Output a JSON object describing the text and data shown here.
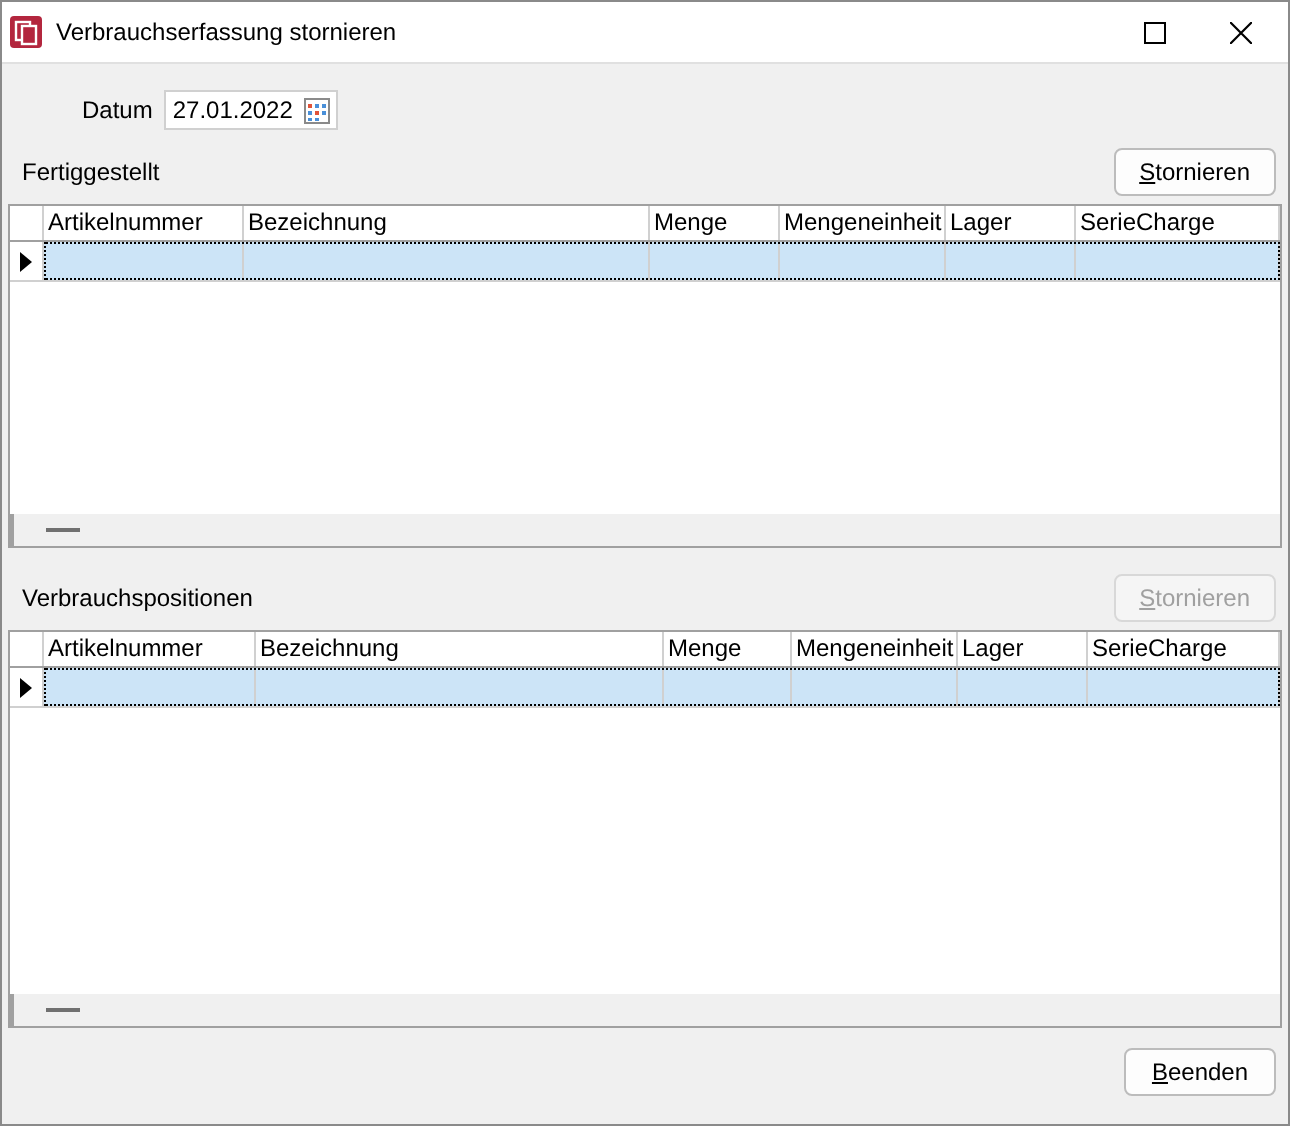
{
  "window": {
    "title": "Verbrauchserfassung stornieren"
  },
  "date_field": {
    "label": "Datum",
    "value": "27.01.2022"
  },
  "sections": [
    {
      "title": "Fertiggestellt",
      "button": {
        "label": "Stornieren",
        "disabled": false
      },
      "columns": [
        "Artikelnummer",
        "Bezeichnung",
        "Menge",
        "Mengeneinheit",
        "Lager",
        "SerieCharge"
      ],
      "rows": [
        {
          "selected": true
        }
      ]
    },
    {
      "title": "Verbrauchspositionen",
      "button": {
        "label": "Stornieren",
        "disabled": true
      },
      "columns": [
        "Artikelnummer",
        "Bezeichnung",
        "Menge",
        "Mengeneinheit",
        "Lager",
        "SerieCharge"
      ],
      "rows": [
        {
          "selected": true
        }
      ]
    }
  ],
  "footer_button": {
    "label": "Beenden"
  }
}
